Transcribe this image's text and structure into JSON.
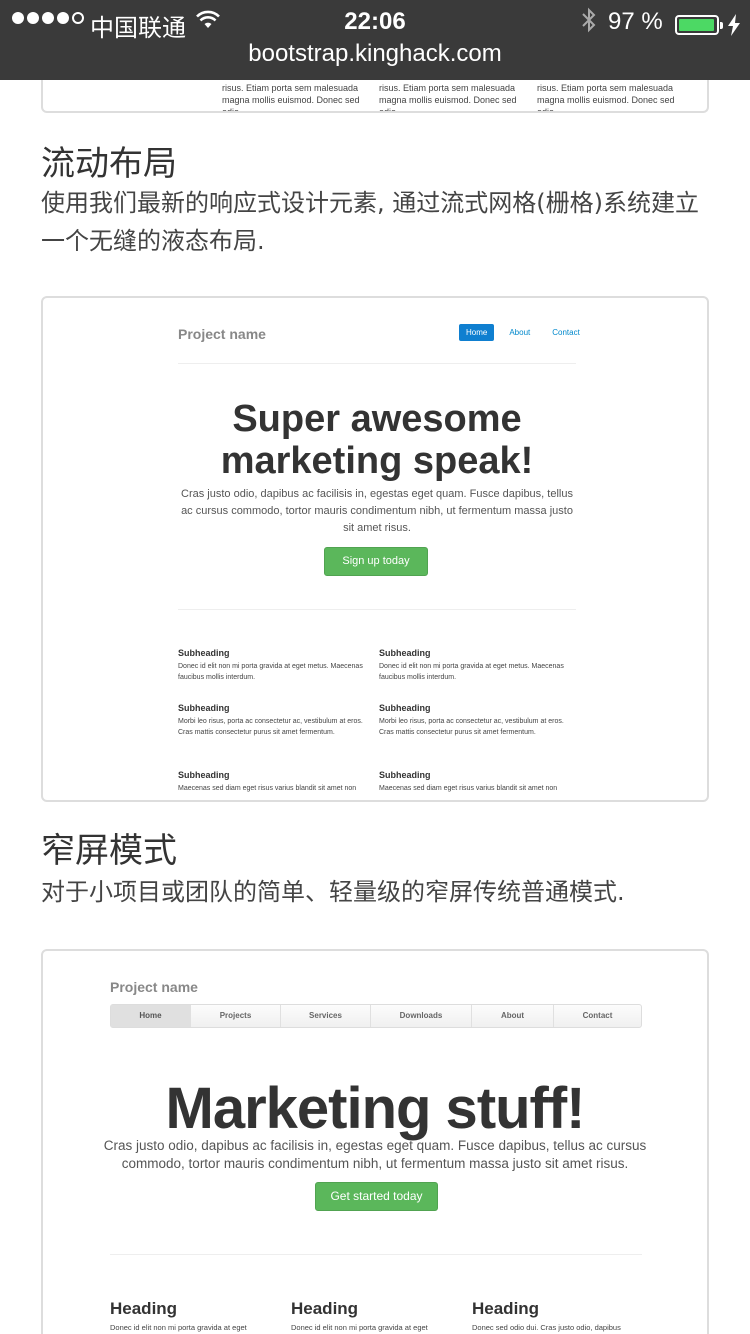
{
  "status_bar": {
    "carrier": "中国联通",
    "time": "22:06",
    "battery_percent": "97 %",
    "battery_level": 0.97,
    "url": "bootstrap.kinghack.com"
  },
  "top_card": {
    "cols": [
      [
        "risus. Etiam porta sem malesuada",
        "magna mollis euismod. Donec sed odio"
      ],
      [
        "risus. Etiam porta sem malesuada",
        "magna mollis euismod. Donec sed odio"
      ],
      [
        "risus. Etiam porta sem malesuada",
        "magna mollis euismod. Donec sed odio"
      ]
    ]
  },
  "fluid": {
    "title": "流动布局",
    "desc": "使用我们最新的响应式设计元素, 通过流式网格(栅格)系统建立一个无缝的液态布局.",
    "preview": {
      "brand": "Project name",
      "nav": [
        "Home",
        "About",
        "Contact"
      ],
      "hero": "Super awesome marketing speak!",
      "lead": "Cras justo odio, dapibus ac facilisis in, egestas eget quam. Fusce dapibus, tellus ac cursus commodo, tortor mauris condimentum nibh, ut fermentum massa justo sit amet risus.",
      "button": "Sign up today",
      "items": [
        {
          "heading": "Subheading",
          "text": "Donec id elit non mi porta gravida at eget metus. Maecenas faucibus mollis interdum."
        },
        {
          "heading": "Subheading",
          "text": "Donec id elit non mi porta gravida at eget metus. Maecenas faucibus mollis interdum."
        },
        {
          "heading": "Subheading",
          "text": "Morbi leo risus, porta ac consectetur ac, vestibulum at eros. Cras mattis consectetur purus sit amet fermentum."
        },
        {
          "heading": "Subheading",
          "text": "Morbi leo risus, porta ac consectetur ac, vestibulum at eros. Cras mattis consectetur purus sit amet fermentum."
        },
        {
          "heading": "Subheading",
          "text": "Maecenas sed diam eget risus varius blandit sit amet non magna."
        },
        {
          "heading": "Subheading",
          "text": "Maecenas sed diam eget risus varius blandit sit amet non magna."
        }
      ]
    }
  },
  "narrow": {
    "title": "窄屏模式",
    "desc": "对于小项目或团队的简单、轻量级的窄屏传统普通模式.",
    "preview": {
      "brand": "Project name",
      "nav": [
        "Home",
        "Projects",
        "Services",
        "Downloads",
        "About",
        "Contact"
      ],
      "hero": "Marketing stuff!",
      "lead": "Cras justo odio, dapibus ac facilisis in, egestas eget quam. Fusce dapibus, tellus ac cursus commodo, tortor mauris condimentum nibh, ut fermentum massa justo sit amet risus.",
      "button": "Get started today",
      "cols": [
        {
          "heading": "Heading",
          "text": "Donec id elit non mi porta gravida at eget"
        },
        {
          "heading": "Heading",
          "text": "Donec id elit non mi porta gravida at eget"
        },
        {
          "heading": "Heading",
          "text": "Donec sed odio dui. Cras justo odio, dapibus"
        }
      ]
    }
  },
  "colors": {
    "status_bg": "#3a3a3a",
    "battery_green": "#4cd964",
    "link_blue": "#0088cc",
    "success_green": "#5bb75b"
  }
}
